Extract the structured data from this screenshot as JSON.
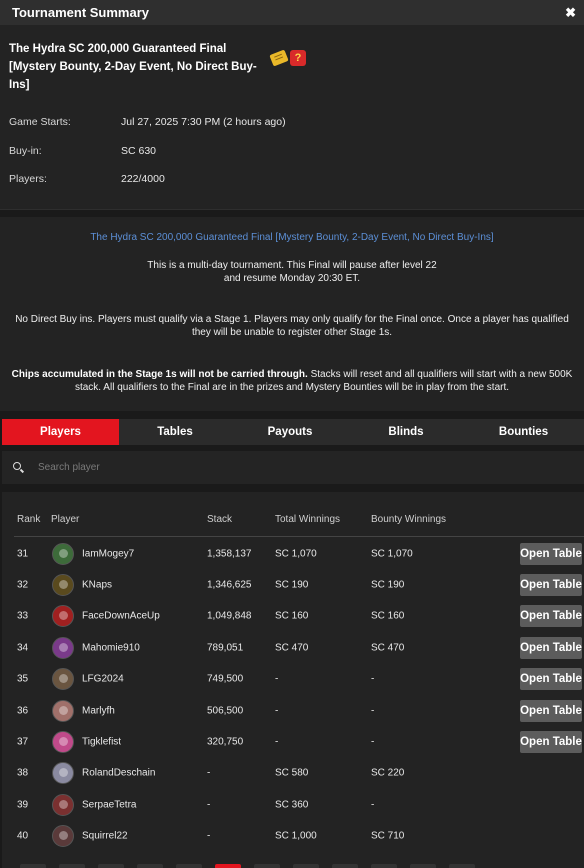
{
  "window": {
    "title": "Tournament Summary",
    "close_symbol": "✖"
  },
  "tournament": {
    "name": "The Hydra SC 200,000 Guaranteed Final [Mystery Bounty, 2-Day Event, No Direct Buy-Ins]",
    "badges": [
      "ticket-icon",
      "mystery-bounty-icon"
    ],
    "mystery_symbol": "?",
    "game_starts_label": "Game Starts:",
    "game_starts_value": "Jul 27, 2025 7:30 PM (2 hours ago)",
    "buyin_label": "Buy-in:",
    "buyin_value": "SC 630",
    "players_label": "Players:",
    "players_value": "222/4000"
  },
  "description": {
    "link": "The Hydra SC 200,000 Guaranteed Final [Mystery Bounty, 2-Day Event, No Direct Buy-Ins]",
    "p1_line1": "This is a multi-day tournament. This Final will pause after level 22",
    "p1_line2": "and resume Monday 20:30 ET.",
    "p2": "No Direct Buy ins. Players must qualify via a Stage 1. Players may only qualify for the Final once. Once a player has qualified they will be unable to register other Stage 1s.",
    "p3_bold": "Chips accumulated in the Stage 1s will not be carried through.",
    "p3_rest": " Stacks will reset and all qualifiers will start with a new 500K stack. All qualifiers to the Final are in the prizes and Mystery Bounties will be in play from the start."
  },
  "tabs": [
    {
      "label": "Players",
      "active": true
    },
    {
      "label": "Tables",
      "active": false
    },
    {
      "label": "Payouts",
      "active": false
    },
    {
      "label": "Blinds",
      "active": false
    },
    {
      "label": "Bounties",
      "active": false
    }
  ],
  "search": {
    "placeholder": "Search player",
    "value": ""
  },
  "table": {
    "headers": {
      "rank": "Rank",
      "player": "Player",
      "stack": "Stack",
      "total": "Total Winnings",
      "bounty": "Bounty Winnings"
    },
    "open_label": "Open Table",
    "rows": [
      {
        "rank": "31",
        "player": "IamMogey7",
        "stack": "1,358,137",
        "total": "SC 1,070",
        "bounty": "SC 1,070",
        "open": true,
        "avatar_color": "#3d6b3a"
      },
      {
        "rank": "32",
        "player": "KNaps",
        "stack": "1,346,625",
        "total": "SC 190",
        "bounty": "SC 190",
        "open": true,
        "avatar_color": "#5a4a1e"
      },
      {
        "rank": "33",
        "player": "FaceDownAceUp",
        "stack": "1,049,848",
        "total": "SC 160",
        "bounty": "SC 160",
        "open": true,
        "avatar_color": "#a02020"
      },
      {
        "rank": "34",
        "player": "Mahomie910",
        "stack": "789,051",
        "total": "SC 470",
        "bounty": "SC 470",
        "open": true,
        "avatar_color": "#7a3a8a"
      },
      {
        "rank": "35",
        "player": "LFG2024",
        "stack": "749,500",
        "total": "-",
        "bounty": "-",
        "open": true,
        "avatar_color": "#6a5540"
      },
      {
        "rank": "36",
        "player": "Marlyfh",
        "stack": "506,500",
        "total": "-",
        "bounty": "-",
        "open": true,
        "avatar_color": "#a0706a"
      },
      {
        "rank": "37",
        "player": "Tigklefist",
        "stack": "320,750",
        "total": "-",
        "bounty": "-",
        "open": true,
        "avatar_color": "#c04a8a"
      },
      {
        "rank": "38",
        "player": "RolandDeschain",
        "stack": "-",
        "total": "SC 580",
        "bounty": "SC 220",
        "open": false,
        "avatar_color": "#8a8aa0"
      },
      {
        "rank": "39",
        "player": "SerpaeTetra",
        "stack": "-",
        "total": "SC 360",
        "bounty": "-",
        "open": false,
        "avatar_color": "#7a3030"
      },
      {
        "rank": "40",
        "player": "Squirrel22",
        "stack": "-",
        "total": "SC 1,000",
        "bounty": "SC 710",
        "open": false,
        "avatar_color": "#5a3a3a"
      }
    ]
  },
  "pager": {
    "active_index": 5,
    "count": 12
  }
}
